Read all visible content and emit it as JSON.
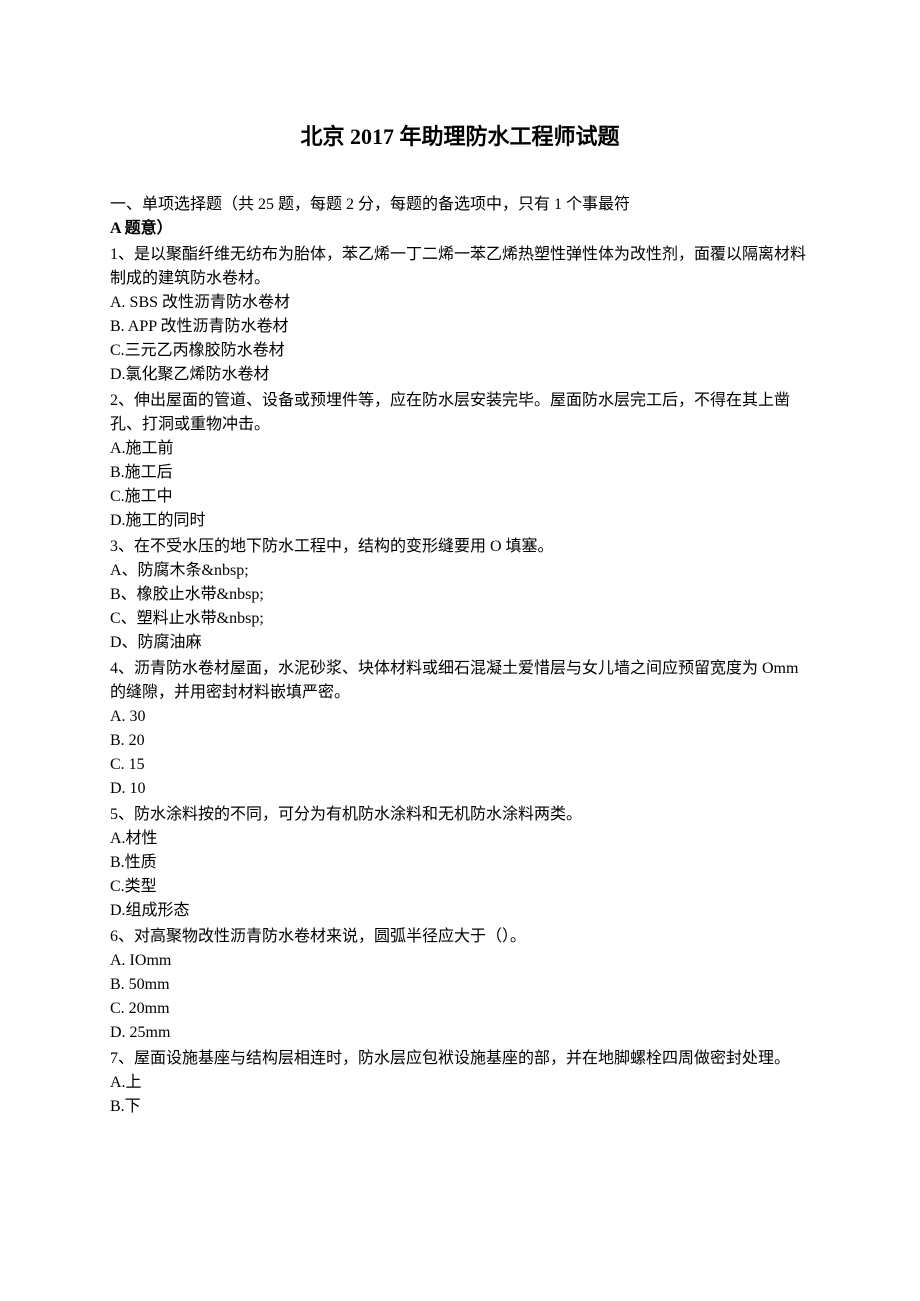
{
  "title": "北京 2017 年助理防水工程师试题",
  "section_header_line1": "一、单项选择题（共 25 题，每题 2 分，每题的备选项中，只有 1 个事最符",
  "section_header_line2": "A 题意）",
  "questions": [
    {
      "text": "1、是以聚酯纤维无纺布为胎体，苯乙烯一丁二烯一苯乙烯热塑性弹性体为改性剂，面覆以隔离材料制成的建筑防水卷材。",
      "options": [
        "A.   SBS 改性沥青防水卷材",
        "B.   APP 改性沥青防水卷材",
        "C.三元乙丙橡胶防水卷材",
        "D.氯化聚乙烯防水卷材"
      ]
    },
    {
      "text": "2、伸出屋面的管道、设备或预埋件等，应在防水层安装完毕。屋面防水层完工后，不得在其上凿孔、打洞或重物冲击。",
      "options": [
        "A.施工前",
        "B.施工后",
        "C.施工中",
        "D.施工的同时"
      ]
    },
    {
      "text": "3、在不受水压的地下防水工程中，结构的变形缝要用 O 填塞。",
      "options": [
        "A、防腐木条&nbsp;",
        "B、橡胶止水带&nbsp;",
        "C、塑料止水带&nbsp;",
        "D、防腐油麻"
      ]
    },
    {
      "text": "4、沥青防水卷材屋面，水泥砂浆、块体材料或细石混凝土爱惜层与女儿墙之间应预留宽度为 Omm 的缝隙，并用密封材料嵌填严密。",
      "options": [
        "A.   30",
        "B.   20",
        "C.   15",
        "D.   10"
      ]
    },
    {
      "text": "5、防水涂料按的不同，可分为有机防水涂料和无机防水涂料两类。",
      "options": [
        "A.材性",
        "B.性质",
        "C.类型",
        "D.组成形态"
      ]
    },
    {
      "text": "6、对高聚物改性沥青防水卷材来说，圆弧半径应大于（）。",
      "options": [
        "A.   IOmm",
        "B.   50mm",
        "C.   20mm",
        "D.   25mm"
      ]
    },
    {
      "text": "7、屋面设施基座与结构层相连时，防水层应包袱设施基座的部，并在地脚螺栓四周做密封处理。",
      "options": [
        "A.上",
        "B.下"
      ]
    }
  ]
}
